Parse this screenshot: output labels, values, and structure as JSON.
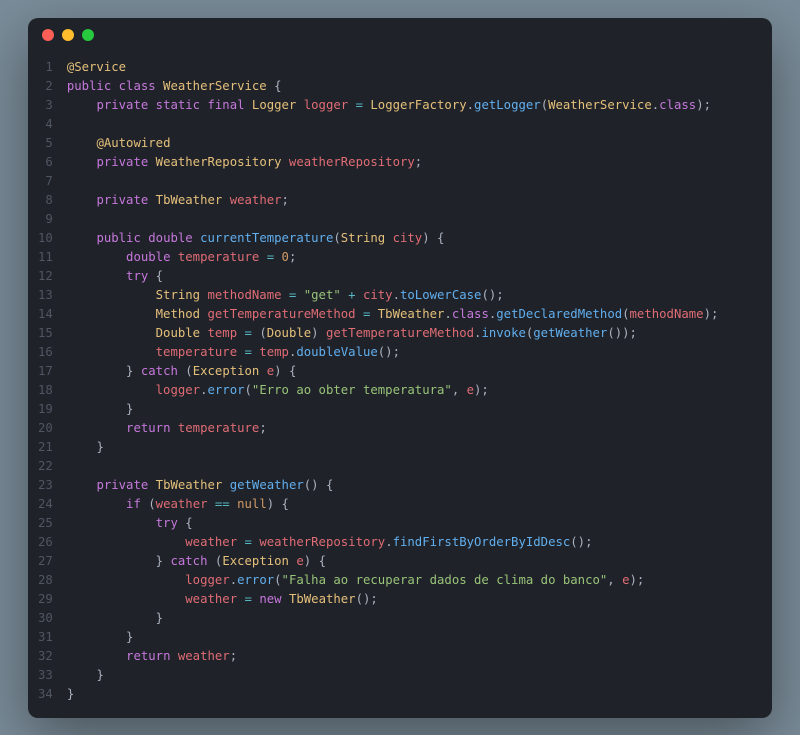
{
  "window": {
    "dots": [
      "red",
      "yellow",
      "green"
    ]
  },
  "code": {
    "line_count": 34,
    "lines": [
      [
        [
          "ann",
          "@Service"
        ]
      ],
      [
        [
          "kw",
          "public class"
        ],
        [
          "",
          ""
        ],
        [
          "type",
          " WeatherService"
        ],
        [
          "punct",
          " {"
        ]
      ],
      [
        [
          "",
          "    "
        ],
        [
          "kw",
          "private static final"
        ],
        [
          "type",
          " Logger"
        ],
        [
          "var",
          " logger"
        ],
        [
          "op",
          " ="
        ],
        [
          "type",
          " LoggerFactory"
        ],
        [
          "punct",
          "."
        ],
        [
          "fn",
          "getLogger"
        ],
        [
          "punct",
          "("
        ],
        [
          "type",
          "WeatherService"
        ],
        [
          "punct",
          "."
        ],
        [
          "kw",
          "class"
        ],
        [
          "punct",
          ");"
        ]
      ],
      [],
      [
        [
          "",
          "    "
        ],
        [
          "ann",
          "@Autowired"
        ]
      ],
      [
        [
          "",
          "    "
        ],
        [
          "kw",
          "private"
        ],
        [
          "type",
          " WeatherRepository"
        ],
        [
          "var",
          " weatherRepository"
        ],
        [
          "punct",
          ";"
        ]
      ],
      [],
      [
        [
          "",
          "    "
        ],
        [
          "kw",
          "private"
        ],
        [
          "type",
          " TbWeather"
        ],
        [
          "var",
          " weather"
        ],
        [
          "punct",
          ";"
        ]
      ],
      [],
      [
        [
          "",
          "    "
        ],
        [
          "kw",
          "public"
        ],
        [
          "kw",
          " double"
        ],
        [
          "fn",
          " currentTemperature"
        ],
        [
          "punct",
          "("
        ],
        [
          "type",
          "String"
        ],
        [
          "var",
          " city"
        ],
        [
          "punct",
          ") {"
        ]
      ],
      [
        [
          "",
          "        "
        ],
        [
          "kw",
          "double"
        ],
        [
          "var",
          " temperature"
        ],
        [
          "op",
          " ="
        ],
        [
          "num",
          " 0"
        ],
        [
          "punct",
          ";"
        ]
      ],
      [
        [
          "",
          "        "
        ],
        [
          "kw",
          "try"
        ],
        [
          "punct",
          " {"
        ]
      ],
      [
        [
          "",
          "            "
        ],
        [
          "type",
          "String"
        ],
        [
          "var",
          " methodName"
        ],
        [
          "op",
          " ="
        ],
        [
          "str",
          " \"get\""
        ],
        [
          "op",
          " +"
        ],
        [
          "var",
          " city"
        ],
        [
          "punct",
          "."
        ],
        [
          "fn",
          "toLowerCase"
        ],
        [
          "punct",
          "();"
        ]
      ],
      [
        [
          "",
          "            "
        ],
        [
          "type",
          "Method"
        ],
        [
          "var",
          " getTemperatureMethod"
        ],
        [
          "op",
          " ="
        ],
        [
          "type",
          " TbWeather"
        ],
        [
          "punct",
          "."
        ],
        [
          "kw",
          "class"
        ],
        [
          "punct",
          "."
        ],
        [
          "fn",
          "getDeclaredMethod"
        ],
        [
          "punct",
          "("
        ],
        [
          "var",
          "methodName"
        ],
        [
          "punct",
          ");"
        ]
      ],
      [
        [
          "",
          "            "
        ],
        [
          "type",
          "Double"
        ],
        [
          "var",
          " temp"
        ],
        [
          "op",
          " ="
        ],
        [
          "punct",
          " ("
        ],
        [
          "type",
          "Double"
        ],
        [
          "punct",
          ") "
        ],
        [
          "var",
          "getTemperatureMethod"
        ],
        [
          "punct",
          "."
        ],
        [
          "fn",
          "invoke"
        ],
        [
          "punct",
          "("
        ],
        [
          "fn",
          "getWeather"
        ],
        [
          "punct",
          "());"
        ]
      ],
      [
        [
          "",
          "            "
        ],
        [
          "var",
          "temperature"
        ],
        [
          "op",
          " ="
        ],
        [
          "var",
          " temp"
        ],
        [
          "punct",
          "."
        ],
        [
          "fn",
          "doubleValue"
        ],
        [
          "punct",
          "();"
        ]
      ],
      [
        [
          "",
          "        "
        ],
        [
          "punct",
          "} "
        ],
        [
          "kw",
          "catch"
        ],
        [
          "punct",
          " ("
        ],
        [
          "type",
          "Exception"
        ],
        [
          "var",
          " e"
        ],
        [
          "punct",
          ") {"
        ]
      ],
      [
        [
          "",
          "            "
        ],
        [
          "var",
          "logger"
        ],
        [
          "punct",
          "."
        ],
        [
          "fn",
          "error"
        ],
        [
          "punct",
          "("
        ],
        [
          "str",
          "\"Erro ao obter temperatura\""
        ],
        [
          "punct",
          ", "
        ],
        [
          "var",
          "e"
        ],
        [
          "punct",
          ");"
        ]
      ],
      [
        [
          "",
          "        "
        ],
        [
          "punct",
          "}"
        ]
      ],
      [
        [
          "",
          "        "
        ],
        [
          "kw",
          "return"
        ],
        [
          "var",
          " temperature"
        ],
        [
          "punct",
          ";"
        ]
      ],
      [
        [
          "",
          "    "
        ],
        [
          "punct",
          "}"
        ]
      ],
      [],
      [
        [
          "",
          "    "
        ],
        [
          "kw",
          "private"
        ],
        [
          "type",
          " TbWeather"
        ],
        [
          "fn",
          " getWeather"
        ],
        [
          "punct",
          "() {"
        ]
      ],
      [
        [
          "",
          "        "
        ],
        [
          "kw",
          "if"
        ],
        [
          "punct",
          " ("
        ],
        [
          "var",
          "weather"
        ],
        [
          "op",
          " =="
        ],
        [
          "const",
          " null"
        ],
        [
          "punct",
          ") {"
        ]
      ],
      [
        [
          "",
          "            "
        ],
        [
          "kw",
          "try"
        ],
        [
          "punct",
          " {"
        ]
      ],
      [
        [
          "",
          "                "
        ],
        [
          "var",
          "weather"
        ],
        [
          "op",
          " ="
        ],
        [
          "var",
          " weatherRepository"
        ],
        [
          "punct",
          "."
        ],
        [
          "fn",
          "findFirstByOrderByIdDesc"
        ],
        [
          "punct",
          "();"
        ]
      ],
      [
        [
          "",
          "            "
        ],
        [
          "punct",
          "} "
        ],
        [
          "kw",
          "catch"
        ],
        [
          "punct",
          " ("
        ],
        [
          "type",
          "Exception"
        ],
        [
          "var",
          " e"
        ],
        [
          "punct",
          ") {"
        ]
      ],
      [
        [
          "",
          "                "
        ],
        [
          "var",
          "logger"
        ],
        [
          "punct",
          "."
        ],
        [
          "fn",
          "error"
        ],
        [
          "punct",
          "("
        ],
        [
          "str",
          "\"Falha ao recuperar dados de clima do banco\""
        ],
        [
          "punct",
          ", "
        ],
        [
          "var",
          "e"
        ],
        [
          "punct",
          ");"
        ]
      ],
      [
        [
          "",
          "                "
        ],
        [
          "var",
          "weather"
        ],
        [
          "op",
          " ="
        ],
        [
          "kw",
          " new"
        ],
        [
          "type",
          " TbWeather"
        ],
        [
          "punct",
          "();"
        ]
      ],
      [
        [
          "",
          "            "
        ],
        [
          "punct",
          "}"
        ]
      ],
      [
        [
          "",
          "        "
        ],
        [
          "punct",
          "}"
        ]
      ],
      [
        [
          "",
          "        "
        ],
        [
          "kw",
          "return"
        ],
        [
          "var",
          " weather"
        ],
        [
          "punct",
          ";"
        ]
      ],
      [
        [
          "",
          "    "
        ],
        [
          "punct",
          "}"
        ]
      ],
      [
        [
          "punct",
          "}"
        ]
      ]
    ]
  }
}
